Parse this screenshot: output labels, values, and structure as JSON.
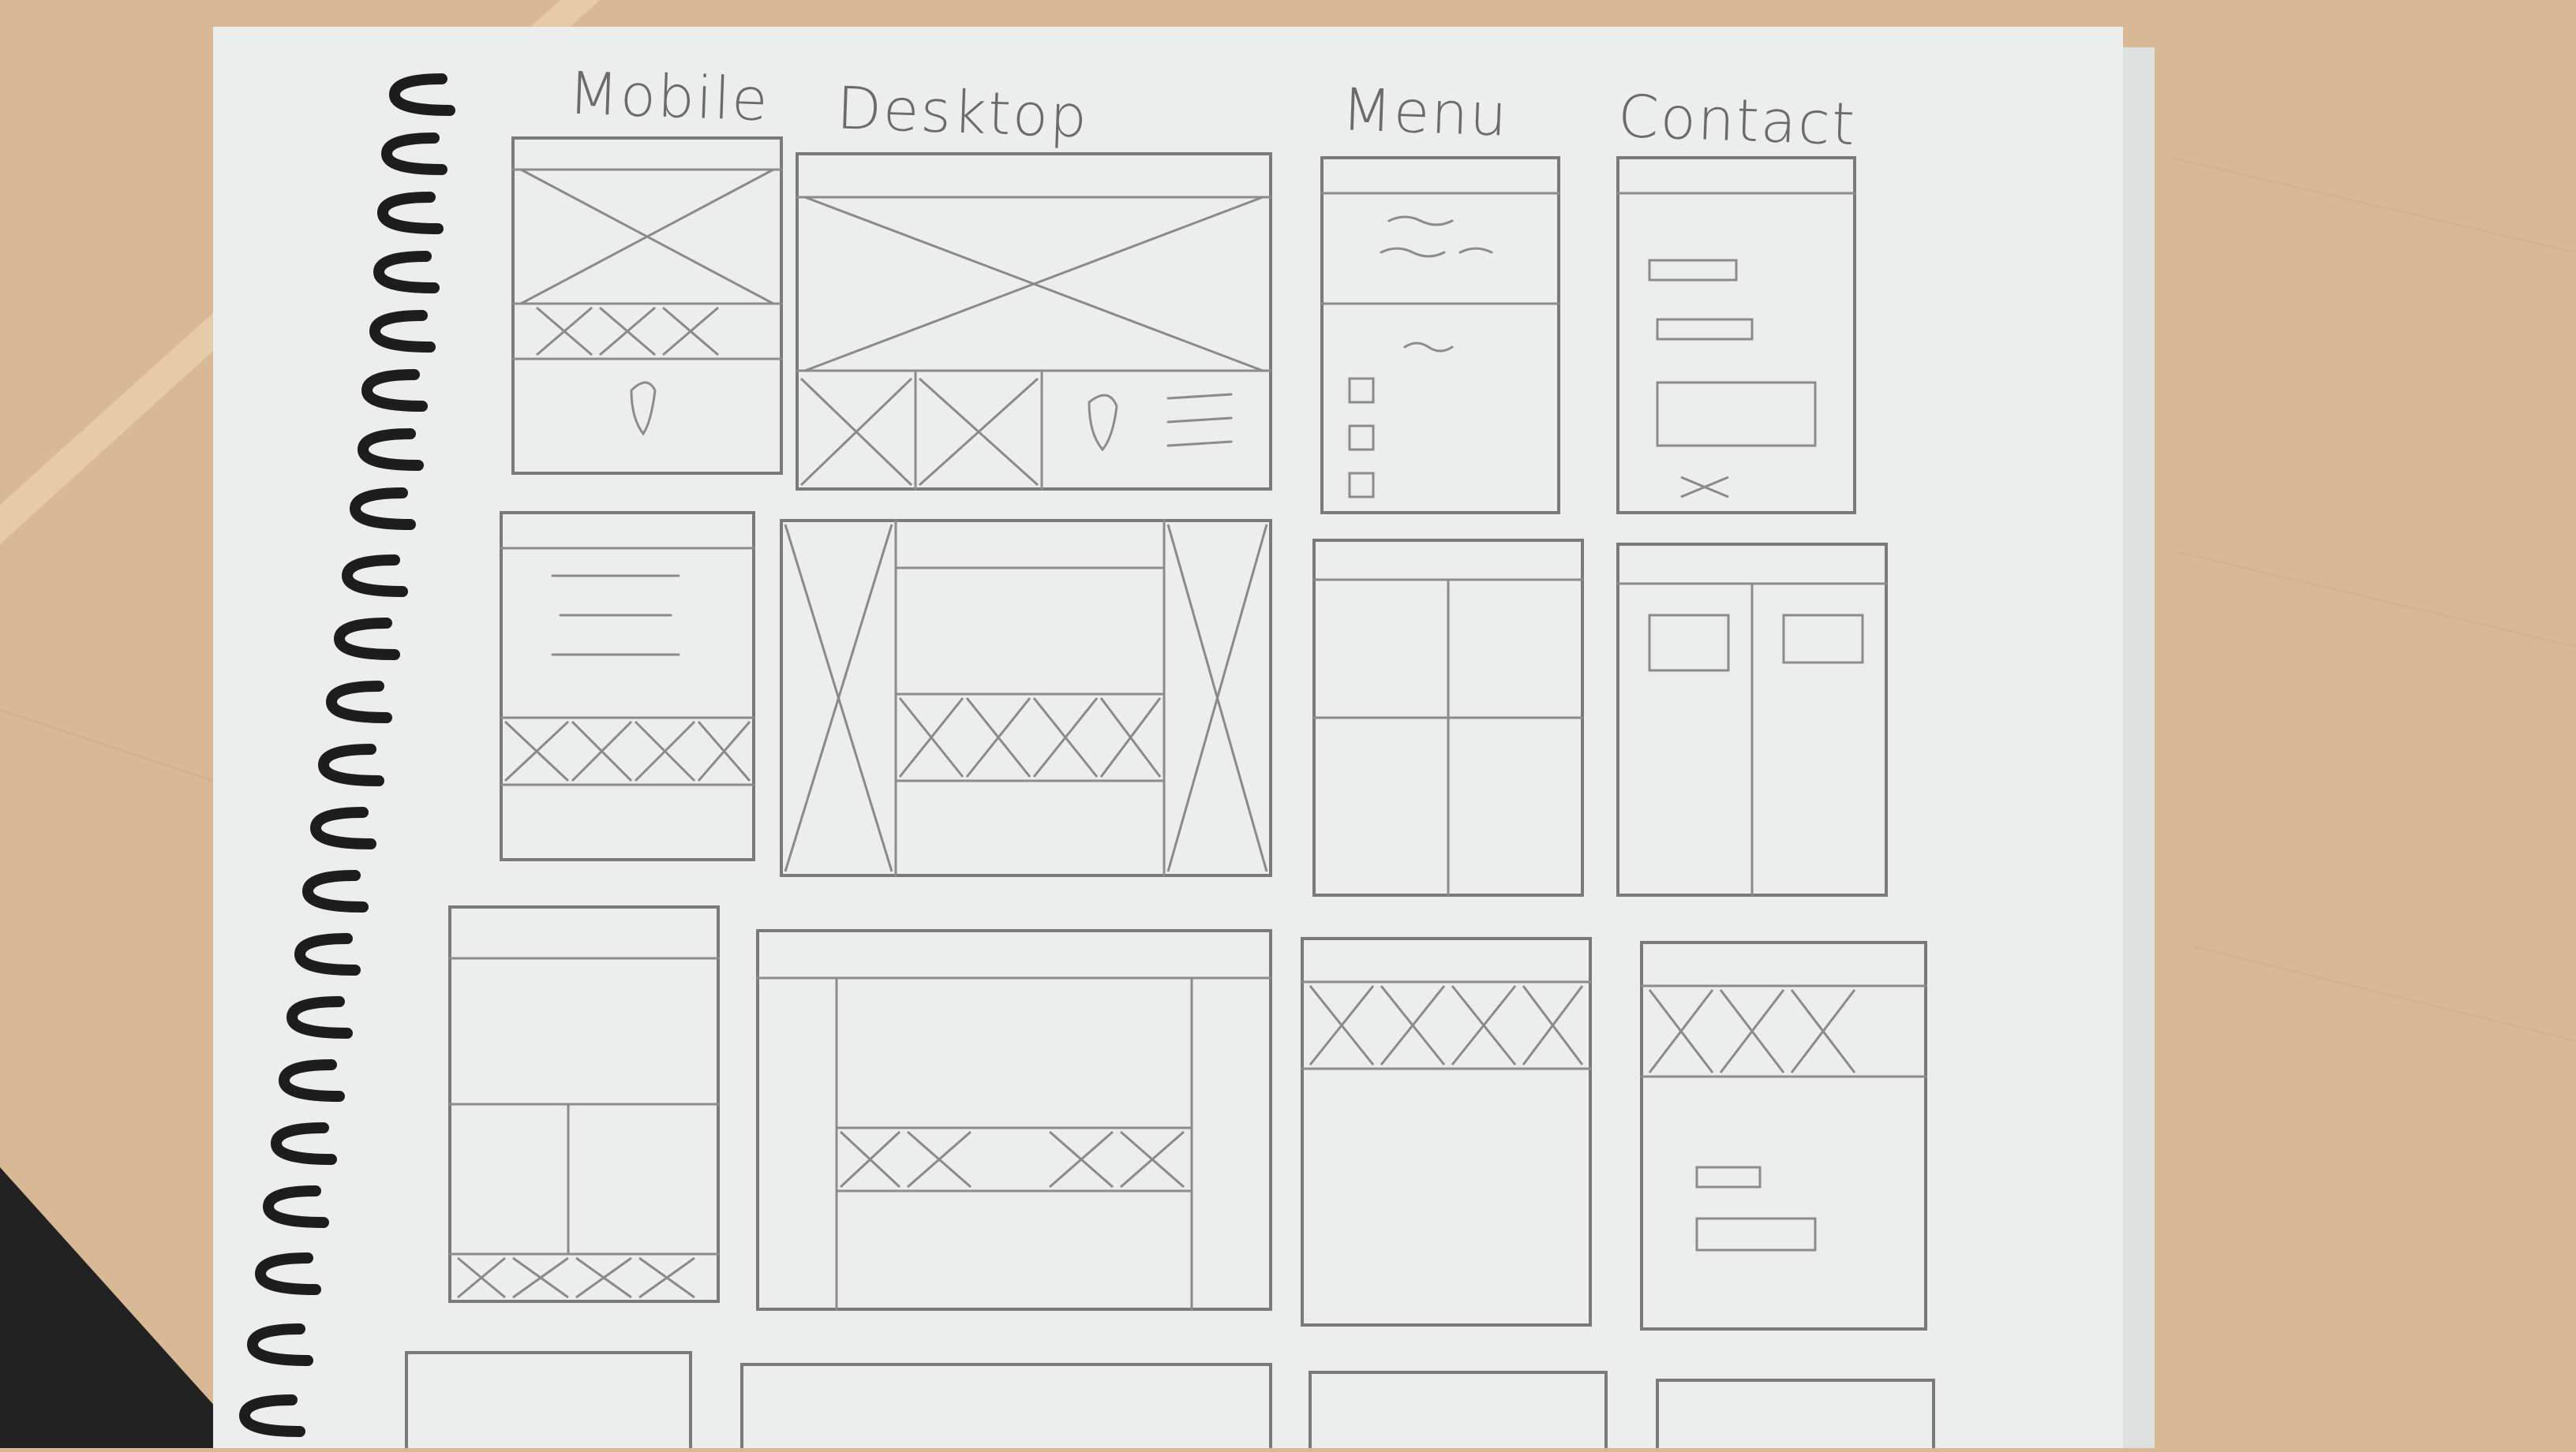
{
  "sketch": {
    "headings": [
      "Mobile",
      "Desktop",
      "Menu",
      "Contact"
    ]
  },
  "colors": {
    "table": "#d8b895",
    "paper": "#eceded",
    "pencil": "#7a7a7a",
    "binding": "#1d1d1d"
  }
}
